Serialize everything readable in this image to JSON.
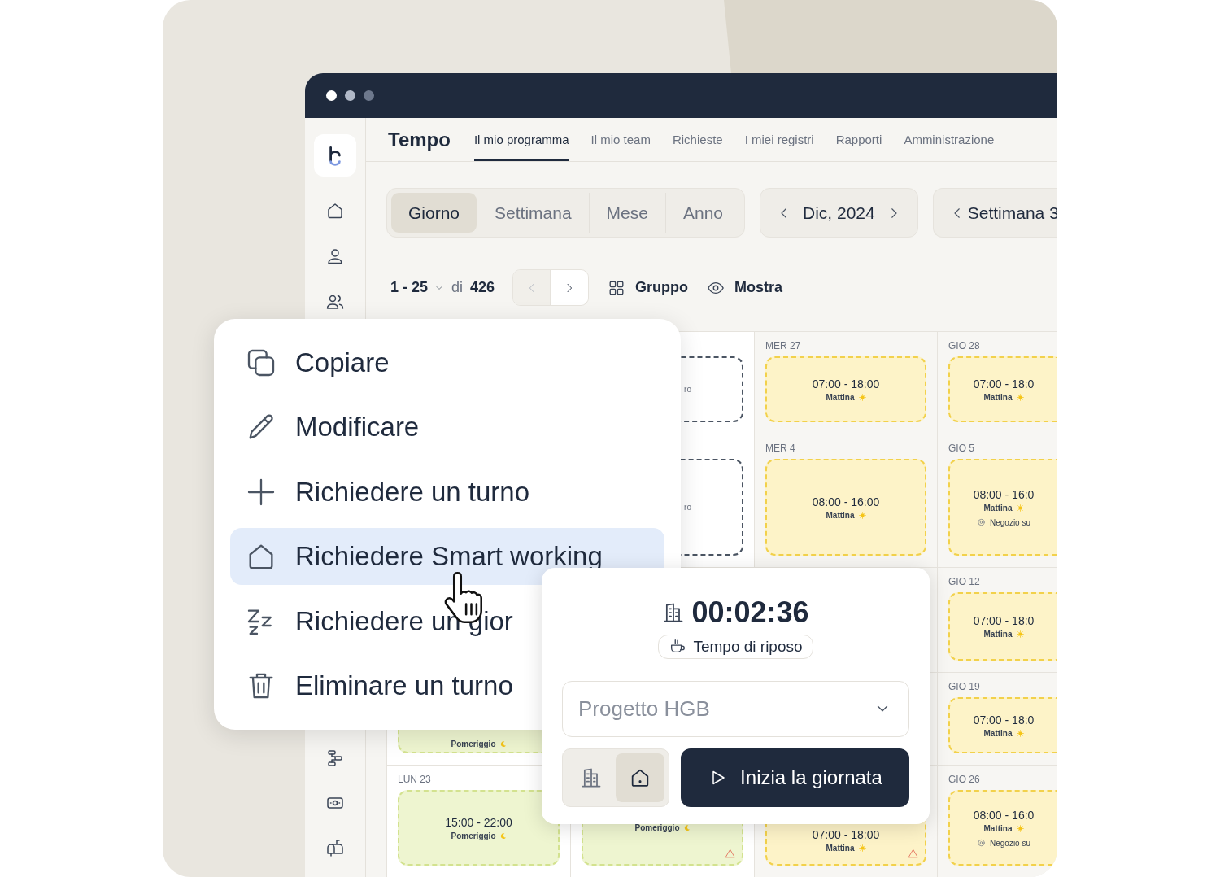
{
  "app": {
    "title": "Tempo"
  },
  "nav_tabs": [
    {
      "label": "Il mio programma",
      "selected": true
    },
    {
      "label": "Il mio team",
      "selected": false
    },
    {
      "label": "Richieste",
      "selected": false
    },
    {
      "label": "I miei registri",
      "selected": false
    },
    {
      "label": "Rapporti",
      "selected": false
    },
    {
      "label": "Amministrazione",
      "selected": false
    }
  ],
  "view_switch": [
    {
      "label": "Giorno",
      "selected": true
    },
    {
      "label": "Settimana",
      "selected": false
    },
    {
      "label": "Mese",
      "selected": false
    },
    {
      "label": "Anno",
      "selected": false
    }
  ],
  "month_nav": {
    "label": "Dic, 2024"
  },
  "week_nav": {
    "label": "Settimana 3"
  },
  "pagination": {
    "range": "1 - 25",
    "of": "di",
    "total": "426",
    "previous_disabled": true
  },
  "toolbar": [
    {
      "kind": "group",
      "label": "Gruppo"
    },
    {
      "kind": "show",
      "label": "Mostra"
    }
  ],
  "calendar": {
    "rows": [
      {
        "cells": [
          {},
          {
            "shift": {
              "kind": "pending",
              "label": "ro",
              "warning": false
            }
          },
          {
            "day": "MER 27",
            "shift": {
              "kind": "morning",
              "time": "07:00 - 18:00",
              "label": "Mattina",
              "warning": false
            }
          },
          {
            "day": "GIO 28",
            "shift": {
              "kind": "morning",
              "time": "07:00 - 18:0",
              "label": "Mattina",
              "warning": false
            }
          }
        ]
      },
      {
        "cells": [
          {},
          {
            "shift": {
              "kind": "pending",
              "label": "ro",
              "warning": false
            }
          },
          {
            "day": "MER 4",
            "shift": {
              "kind": "morning",
              "time": "08:00 - 16:00",
              "label": "Mattina",
              "warning": false
            }
          },
          {
            "day": "GIO 5",
            "shift": {
              "kind": "morning",
              "time": "08:00 - 16:0",
              "label": "Mattina",
              "location": "Negozio su",
              "warning": false
            }
          }
        ]
      },
      {
        "cells": [
          {},
          {},
          {},
          {
            "day": "GIO 12",
            "shift": {
              "kind": "morning",
              "time": "07:00 - 18:0",
              "label": "Mattina",
              "warning": false
            }
          }
        ]
      },
      {
        "cells": [
          {
            "shift": {
              "kind": "afternoon",
              "label": "Pomeriggio"
            }
          },
          {},
          {},
          {
            "day": "GIO 19",
            "shift": {
              "kind": "morning",
              "time": "07:00 - 18:0",
              "label": "Mattina",
              "warning": false
            }
          }
        ]
      },
      {
        "cells": [
          {
            "day": "LUN 23",
            "shift": {
              "kind": "afternoon",
              "time": "15:00 - 22:00",
              "label": "Pomeriggio",
              "warning": false
            }
          },
          {
            "shift": {
              "kind": "afternoon",
              "label": "Pomeriggio",
              "warning": true
            }
          },
          {
            "shift": {
              "kind": "morning",
              "time": "07:00 - 18:00",
              "label": "Mattina",
              "warning": true
            }
          },
          {
            "day": "GIO 26",
            "shift": {
              "kind": "morning",
              "time": "08:00 - 16:0",
              "label": "Mattina",
              "location": "Negozio su",
              "warning": false
            }
          }
        ]
      }
    ]
  },
  "context_menu": {
    "items": [
      {
        "kind": "copy",
        "label": "Copiare",
        "selected": false
      },
      {
        "kind": "edit",
        "label": "Modificare",
        "selected": false
      },
      {
        "kind": "add",
        "label": "Richiedere un turno",
        "selected": false
      },
      {
        "kind": "home",
        "label": "Richiedere Smart working",
        "selected": true
      },
      {
        "kind": "sleep",
        "label": "Richiedere un gior",
        "selected": false
      },
      {
        "kind": "delete",
        "label": "Eliminare un turno",
        "selected": false
      }
    ]
  },
  "clock_panel": {
    "timer": "00:02:36",
    "break_button": "Tempo di riposo",
    "project_select": {
      "placeholder": "Progetto HGB"
    },
    "work_modes": [
      {
        "kind": "office",
        "selected": false
      },
      {
        "kind": "home",
        "selected": true
      }
    ],
    "start_button": "Inizia la giornata"
  }
}
